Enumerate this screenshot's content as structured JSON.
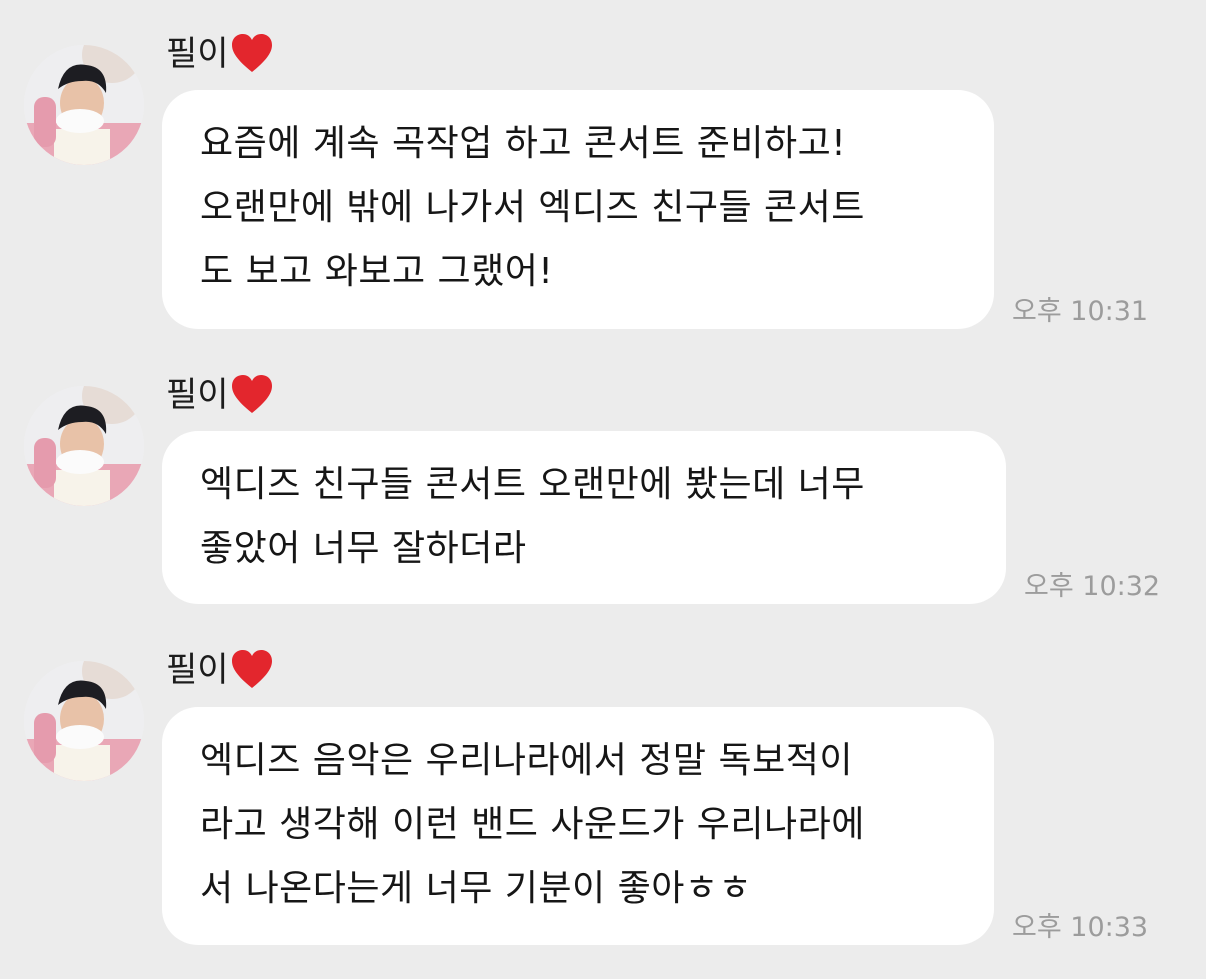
{
  "messages": [
    {
      "sender": "필이",
      "lines": [
        "요즘에 계속 곡작업 하고 콘서트 준비하고!",
        "오랜만에 밖에 나가서 엑디즈 친구들 콘서트",
        "도 보고 와보고 그랬어!"
      ],
      "time": "오후 10:31"
    },
    {
      "sender": "필이",
      "lines": [
        "엑디즈 친구들 콘서트 오랜만에 봤는데 너무",
        "좋았어 너무 잘하더라"
      ],
      "time": "오후 10:32"
    },
    {
      "sender": "필이",
      "lines": [
        "엑디즈 음악은 우리나라에서 정말 독보적이",
        "라고 생각해 이런 밴드 사운드가 우리나라에",
        "서 나온다는게 너무 기분이 좋아ㅎㅎ"
      ],
      "time": "오후 10:33"
    }
  ],
  "colors": {
    "background": "#ececec",
    "bubble": "#ffffff",
    "timestamp": "#9c9c9c",
    "heart": "#e3262d"
  },
  "icons": {
    "sender_badge": "red-heart-icon"
  }
}
